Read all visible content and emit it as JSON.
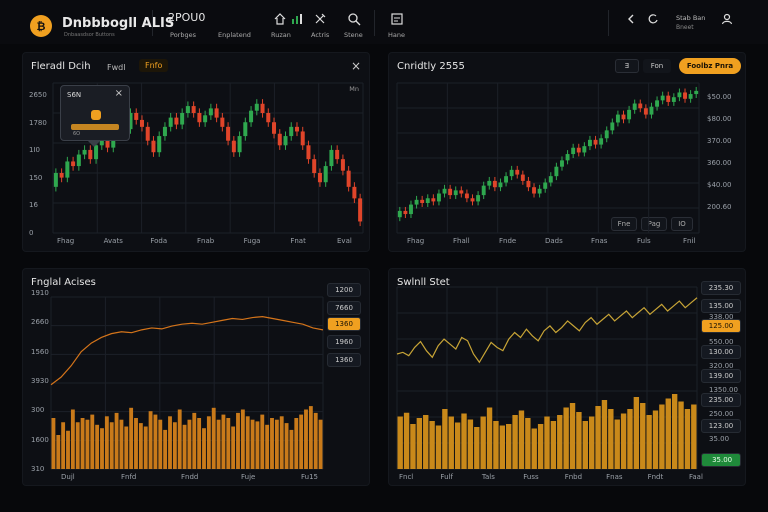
{
  "header": {
    "brand": "Dnbbbogll ALIS",
    "brand_sub": "Dnbaasdsor Buttons",
    "logo_glyph": "₿",
    "price": "2POU0",
    "nav": [
      "Porbges",
      "Enplatend",
      "Ruzan",
      "Actris",
      "Stene",
      "Hane"
    ],
    "right_label": "Stab Ban",
    "right_sub": "Bneet"
  },
  "colors": {
    "accent": "#f0a020",
    "up": "#2fa84f",
    "down": "#e0452a",
    "bar": "#c97a1a",
    "grid": "#1c2028"
  },
  "panel1": {
    "title": "Fleradl Dcih",
    "tabs": [
      "Fwdl",
      "Fnfo"
    ],
    "active_tab": 1,
    "close": "×",
    "corner_label": "Mn",
    "tooltip": {
      "title": "S6N",
      "value": "6O"
    },
    "y_labels": [
      "2650",
      "1780",
      "1I0",
      "150",
      "16",
      "0"
    ],
    "x_labels": [
      "Fhag",
      "Avats",
      "Foda",
      "Fnab",
      "Fuga",
      "Fnat",
      "Eval"
    ]
  },
  "panel2": {
    "title": "Cnridtly 2555",
    "buttons": [
      "Ǝ",
      "Fon"
    ],
    "action_button": "Foolbz Pnra",
    "y_labels": [
      "$50.00",
      "$80.00",
      "370.00",
      "360.00",
      "$40.00",
      "200.60"
    ],
    "x_labels": [
      "Fhag",
      "Fhall",
      "Fnde",
      "Dads",
      "Fnas",
      "Fuls",
      "Fnil"
    ],
    "mini_buttons": [
      "Fne",
      "Pag",
      "IO"
    ]
  },
  "panel3": {
    "title": "Fnglal Acises",
    "y_labels": [
      "1910",
      "2660",
      "1560",
      "3930",
      "300",
      "1600",
      "310"
    ],
    "x_labels": [
      "Dujl",
      "Fnfd",
      "Fndd",
      "Fuje",
      "Fu15"
    ],
    "pills": [
      {
        "text": "1200",
        "style": "dark"
      },
      {
        "text": "7660",
        "style": "dark"
      },
      {
        "text": "1360",
        "style": "orange"
      },
      {
        "text": "1960",
        "style": "dark"
      },
      {
        "text": "1360",
        "style": "dark"
      }
    ]
  },
  "panel4": {
    "title": "Swlnll Stet",
    "y_labels": [
      "3SS.00",
      "338.00",
      "550.00",
      "320.00",
      "1350.00",
      "250.00",
      "35.00",
      "238.00"
    ],
    "x_labels": [
      "Fncl",
      "Fulf",
      "Tals",
      "Fuss",
      "Fnbd",
      "Fnas",
      "Fndt",
      "Faal"
    ],
    "pills": [
      {
        "text": "235.30",
        "style": "dark"
      },
      {
        "text": "135.00",
        "style": "dark"
      },
      {
        "text": "125.00",
        "style": "orange"
      },
      {
        "text": "130.00",
        "style": "dark"
      },
      {
        "text": "139.00",
        "style": "dark"
      },
      {
        "text": "235.00",
        "style": "dark"
      },
      {
        "text": "123.00",
        "style": "dark"
      },
      {
        "text": " 35.00",
        "style": "green"
      }
    ]
  },
  "chart_data": [
    {
      "type": "candlestick",
      "candles": [
        [
          40,
          52
        ],
        [
          52,
          48
        ],
        [
          48,
          62
        ],
        [
          62,
          58
        ],
        [
          58,
          68
        ],
        [
          68,
          72
        ],
        [
          72,
          64
        ],
        [
          64,
          76
        ],
        [
          76,
          82
        ],
        [
          82,
          74
        ],
        [
          74,
          86
        ],
        [
          86,
          96
        ],
        [
          96,
          90
        ],
        [
          90,
          104
        ],
        [
          104,
          98
        ],
        [
          98,
          92
        ],
        [
          92,
          80
        ],
        [
          80,
          70
        ],
        [
          70,
          84
        ],
        [
          84,
          92
        ],
        [
          92,
          100
        ],
        [
          100,
          94
        ],
        [
          94,
          104
        ],
        [
          104,
          110
        ],
        [
          110,
          104
        ],
        [
          104,
          96
        ],
        [
          96,
          102
        ],
        [
          102,
          108
        ],
        [
          108,
          100
        ],
        [
          100,
          92
        ],
        [
          92,
          80
        ],
        [
          80,
          70
        ],
        [
          70,
          84
        ],
        [
          84,
          96
        ],
        [
          96,
          106
        ],
        [
          106,
          112
        ],
        [
          112,
          104
        ],
        [
          104,
          96
        ],
        [
          96,
          86
        ],
        [
          86,
          76
        ],
        [
          76,
          84
        ],
        [
          84,
          92
        ],
        [
          92,
          88
        ],
        [
          88,
          76
        ],
        [
          76,
          64
        ],
        [
          64,
          52
        ],
        [
          52,
          44
        ],
        [
          44,
          58
        ],
        [
          58,
          72
        ],
        [
          72,
          64
        ],
        [
          64,
          54
        ],
        [
          54,
          40
        ],
        [
          40,
          30
        ],
        [
          30,
          10
        ]
      ],
      "ylim": [
        0,
        130
      ]
    },
    {
      "type": "candlestick",
      "candles": [
        [
          20,
          28
        ],
        [
          28,
          24
        ],
        [
          24,
          36
        ],
        [
          36,
          42
        ],
        [
          42,
          38
        ],
        [
          38,
          44
        ],
        [
          44,
          40
        ],
        [
          40,
          50
        ],
        [
          50,
          56
        ],
        [
          56,
          48
        ],
        [
          48,
          54
        ],
        [
          54,
          50
        ],
        [
          50,
          44
        ],
        [
          44,
          40
        ],
        [
          40,
          48
        ],
        [
          48,
          60
        ],
        [
          60,
          66
        ],
        [
          66,
          58
        ],
        [
          58,
          64
        ],
        [
          64,
          72
        ],
        [
          72,
          80
        ],
        [
          80,
          74
        ],
        [
          74,
          66
        ],
        [
          66,
          58
        ],
        [
          58,
          50
        ],
        [
          50,
          56
        ],
        [
          56,
          64
        ],
        [
          64,
          72
        ],
        [
          72,
          84
        ],
        [
          84,
          92
        ],
        [
          92,
          100
        ],
        [
          100,
          108
        ],
        [
          108,
          102
        ],
        [
          102,
          110
        ],
        [
          110,
          118
        ],
        [
          118,
          112
        ],
        [
          112,
          120
        ],
        [
          120,
          130
        ],
        [
          130,
          140
        ],
        [
          140,
          150
        ],
        [
          150,
          144
        ],
        [
          144,
          156
        ],
        [
          156,
          164
        ],
        [
          164,
          158
        ],
        [
          158,
          150
        ],
        [
          150,
          160
        ],
        [
          160,
          168
        ],
        [
          168,
          174
        ],
        [
          174,
          166
        ],
        [
          166,
          172
        ],
        [
          172,
          178
        ],
        [
          178,
          170
        ],
        [
          170,
          176
        ],
        [
          176,
          180
        ]
      ],
      "ylim": [
        0,
        190
      ]
    },
    {
      "type": "line+bar",
      "line": [
        20,
        28,
        40,
        55,
        64,
        70,
        74,
        76,
        75,
        78,
        80,
        79,
        82,
        84,
        85,
        84,
        86,
        88,
        90,
        89,
        91,
        92,
        90,
        88,
        86,
        84,
        80,
        78
      ],
      "bars": [
        60,
        40,
        55,
        45,
        70,
        55,
        60,
        58,
        64,
        52,
        48,
        62,
        55,
        66,
        58,
        50,
        72,
        60,
        54,
        50,
        68,
        64,
        58,
        46,
        62,
        55,
        70,
        52,
        58,
        66,
        60,
        48,
        62,
        72,
        58,
        64,
        60,
        50,
        66,
        70,
        62,
        58,
        56,
        64,
        52,
        60,
        58,
        62,
        54,
        46,
        60,
        64,
        70,
        74,
        66,
        58
      ]
    },
    {
      "type": "line+bar",
      "line": [
        40,
        42,
        38,
        48,
        55,
        44,
        36,
        50,
        58,
        52,
        46,
        60,
        56,
        40,
        30,
        42,
        54,
        48,
        44,
        58,
        66,
        60,
        70,
        62,
        56,
        68,
        74,
        66,
        72,
        80,
        74,
        68,
        78,
        84,
        76,
        82,
        88,
        80,
        86,
        92,
        84,
        90,
        96,
        88,
        94,
        100,
        92,
        98,
        104,
        96,
        102,
        108
      ],
      "bars": [
        70,
        75,
        60,
        68,
        72,
        64,
        58,
        80,
        70,
        62,
        74,
        66,
        56,
        70,
        82,
        64,
        58,
        60,
        72,
        78,
        68,
        54,
        60,
        70,
        64,
        72,
        82,
        88,
        76,
        64,
        70,
        84,
        92,
        80,
        66,
        74,
        80,
        96,
        88,
        72,
        78,
        86,
        94,
        100,
        90,
        80,
        86
      ]
    }
  ]
}
